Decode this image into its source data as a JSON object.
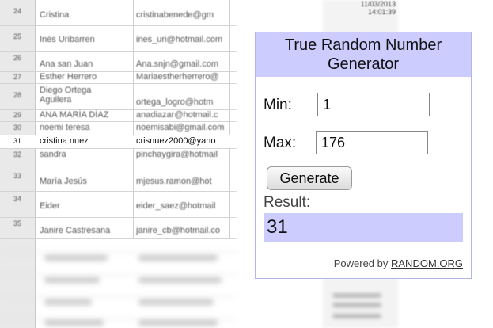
{
  "spreadsheet": {
    "rows": [
      {
        "num": "24",
        "name": "Cristina",
        "email": "cristinabenede@gm"
      },
      {
        "num": "25",
        "name": "Inés Uribarren",
        "email": "ines_uri@hotmail.com"
      },
      {
        "num": "26",
        "name": "Ana san Juan",
        "email": "Ana.snjn@gmail.com"
      },
      {
        "num": "27",
        "name": "Esther Herrero",
        "email": "Mariaestherherrero@"
      },
      {
        "num": "28",
        "name": "Diego Ortega Aguilera",
        "email": "ortega_logro@hotm"
      },
      {
        "num": "29",
        "name": "ANA MARÍA DÍAZ",
        "email": "anadiazar@hotmail.c"
      },
      {
        "num": "30",
        "name": "noemi teresa",
        "email": "noemisabi@gmail.com"
      },
      {
        "num": "31",
        "name": "cristina nuez",
        "email": "crisnuez2000@yaho"
      },
      {
        "num": "32",
        "name": "sandra",
        "email": "pinchaygira@hotmail"
      },
      {
        "num": "33",
        "name": "María Jesús",
        "email": "mjesus.ramon@hot"
      },
      {
        "num": "34",
        "name": "Eider",
        "email": "eider_saez@hotmail"
      },
      {
        "num": "35",
        "name": "Janire Castresana",
        "email": "janire_cb@hotmail.co"
      }
    ],
    "date_text": "11/03/2013\n14:01:39"
  },
  "widget": {
    "title_line1": "True Random Number",
    "title_line2": "Generator",
    "min_label": "Min:",
    "min_value": "1",
    "max_label": "Max:",
    "max_value": "176",
    "generate_label": "Generate",
    "result_label": "Result:",
    "result_value": "31",
    "powered_by": "Powered by",
    "powered_link": "RANDOM.ORG"
  },
  "colors": {
    "widget_accent": "#ccccff",
    "row_border": "#d4d4d4"
  }
}
